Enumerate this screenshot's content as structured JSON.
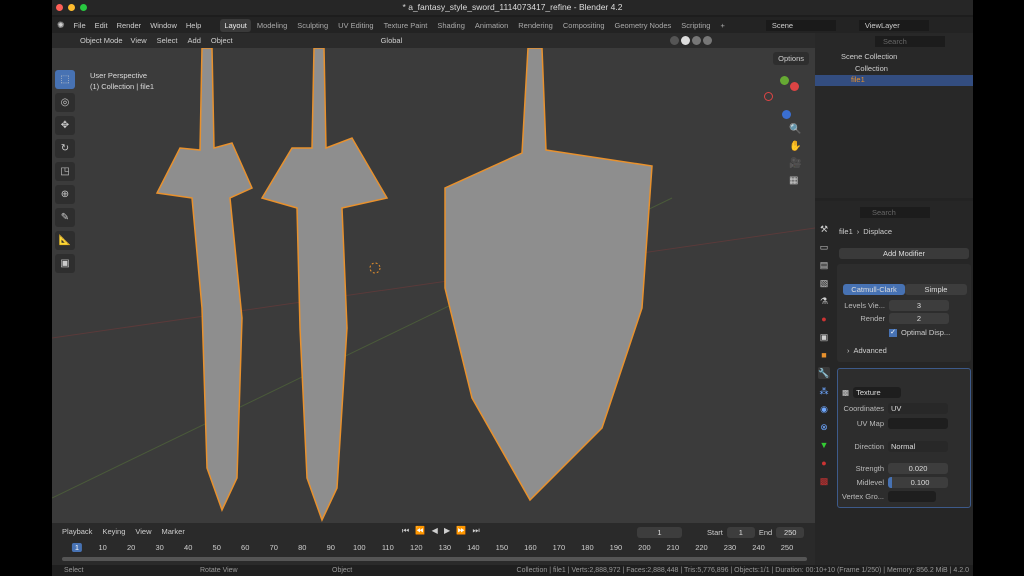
{
  "window": {
    "title": "* a_fantasy_style_sword_1114073417_refine - Blender 4.2"
  },
  "menu": [
    "File",
    "Edit",
    "Render",
    "Window",
    "Help"
  ],
  "workspaces": [
    "Layout",
    "Modeling",
    "Sculpting",
    "UV Editing",
    "Texture Paint",
    "Shading",
    "Animation",
    "Rendering",
    "Compositing",
    "Geometry Nodes",
    "Scripting",
    "+"
  ],
  "active_workspace": "Layout",
  "scene": "Scene",
  "view_layer": "ViewLayer",
  "viewport_header": {
    "mode": "Object Mode",
    "menus": [
      "View",
      "Select",
      "Add",
      "Object"
    ],
    "orientation": "Global",
    "options": "Options"
  },
  "viewport": {
    "perspective": "User Perspective",
    "collection_info": "(1) Collection | file1"
  },
  "outliner": {
    "search_placeholder": "Search",
    "root": "Scene Collection",
    "collection": "Collection",
    "object": "file1"
  },
  "properties": {
    "search_placeholder": "Search",
    "breadcrumb_object": "file1",
    "breadcrumb_modifier": "Displace",
    "add_modifier": "Add Modifier",
    "subsurf": {
      "tab_catmull": "Catmull-Clark",
      "tab_simple": "Simple",
      "levels_label": "Levels Vie...",
      "levels_value": "3",
      "render_label": "Render",
      "render_value": "2",
      "optimal_label": "Optimal Disp...",
      "optimal_checked": true,
      "advanced": "Advanced"
    },
    "displace": {
      "texture": "Texture",
      "coordinates_label": "Coordinates",
      "coordinates_value": "UV",
      "uvmap_label": "UV Map",
      "direction_label": "Direction",
      "direction_value": "Normal",
      "strength_label": "Strength",
      "strength_value": "0.020",
      "midlevel_label": "Midlevel",
      "midlevel_value": "0.100",
      "vertex_group_label": "Vertex Gro..."
    }
  },
  "timeline": {
    "menus": [
      "Playback",
      "Keying",
      "View",
      "Marker"
    ],
    "current_frame": "1",
    "start_label": "Start",
    "start": "1",
    "end_label": "End",
    "end": "250",
    "ticks": [
      "1",
      "10",
      "20",
      "30",
      "40",
      "50",
      "60",
      "70",
      "80",
      "90",
      "100",
      "110",
      "120",
      "130",
      "140",
      "150",
      "160",
      "170",
      "180",
      "190",
      "200",
      "210",
      "220",
      "230",
      "240",
      "250"
    ]
  },
  "status": {
    "select": "Select",
    "rotate": "Rotate View",
    "object": "Object",
    "stats": "Collection | file1 | Verts:2,888,972 | Faces:2,888,448 | Tris:5,776,896 | Objects:1/1 | Duration: 00:10+10 (Frame 1/250) | Memory: 856.2 MiB | 4.2.0"
  },
  "colors": {
    "accent": "#4772b3",
    "selection_outline": "#e8912d"
  }
}
